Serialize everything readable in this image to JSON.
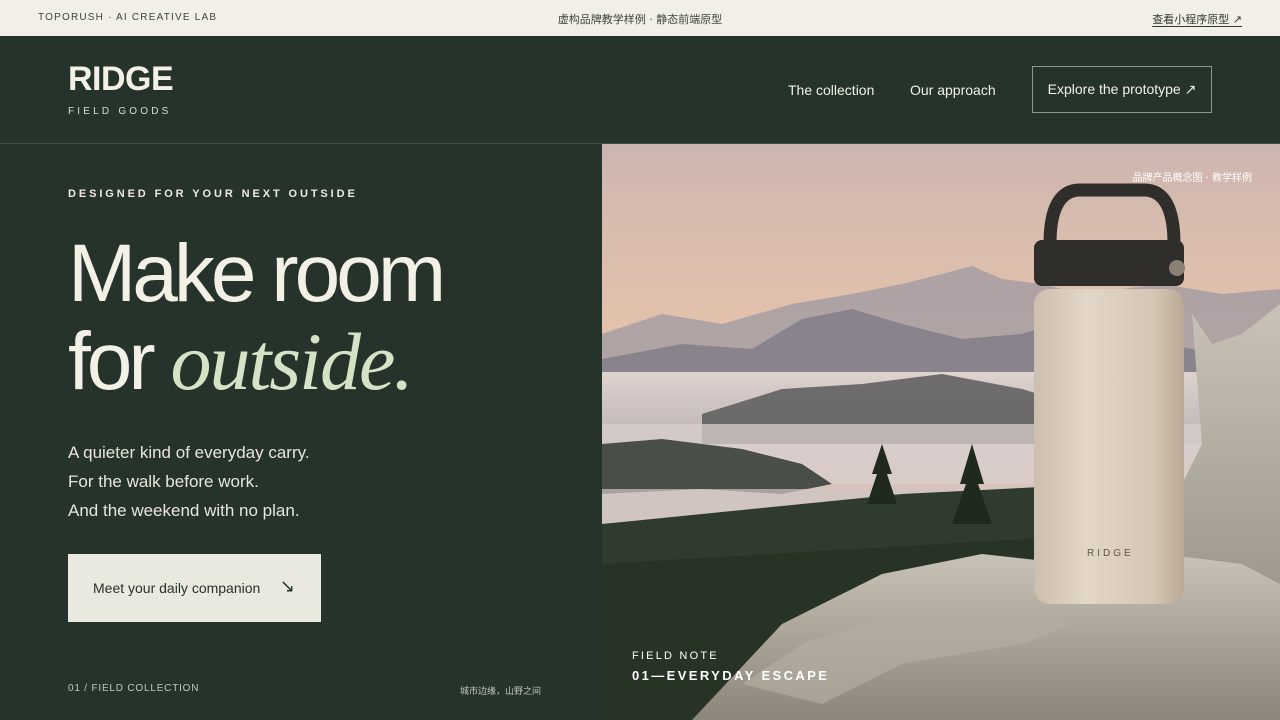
{
  "topbar": {
    "left": "TOPORUSH · AI CREATIVE LAB",
    "center": "虚构品牌教学样例 · 静态前端原型",
    "right": "查看小程序原型 ↗"
  },
  "header": {
    "logo": "RIDGE",
    "logo_sub": "FIELD GOODS",
    "nav": [
      "The collection",
      "Our approach"
    ],
    "cta": "Explore the prototype ↗"
  },
  "hero": {
    "eyebrow": "DESIGNED FOR YOUR NEXT OUTSIDE",
    "headline_line1": "Make room",
    "headline_line2_prefix": "for ",
    "headline_line2_accent": "outside.",
    "body": [
      "A quieter kind of everyday carry.",
      "For the walk before work.",
      "And the weekend with no plan."
    ],
    "cta_label": "Meet your daily companion",
    "cta_arrow": "↘",
    "foot_left": "01 / FIELD COLLECTION",
    "foot_right": "城市边缘，山野之间"
  },
  "image": {
    "caption": "品牌产品概念图 · 教学样例",
    "bottle_brand": "RIDGE",
    "field_note_label": "FIELD NOTE",
    "field_note_title": "01—EVERYDAY ESCAPE"
  },
  "colors": {
    "forest": "#25332b",
    "cream": "#f1efe7",
    "accent_sage": "#d5e2c5"
  }
}
